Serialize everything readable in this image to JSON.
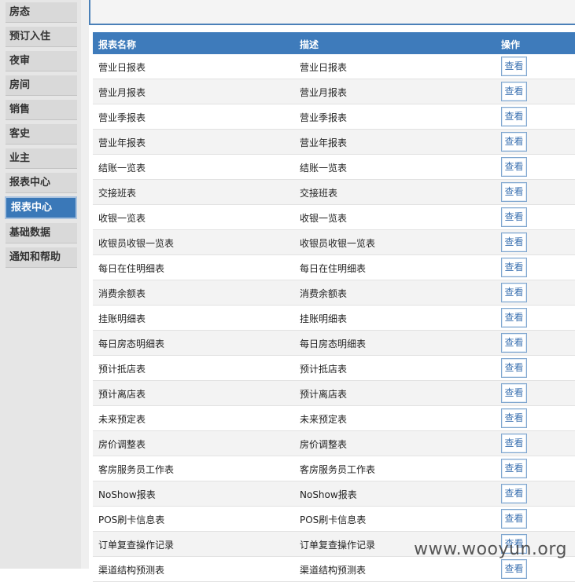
{
  "sidebar": {
    "items": [
      {
        "label": "房态"
      },
      {
        "label": "预订入住"
      },
      {
        "label": "夜审"
      },
      {
        "label": "房间"
      },
      {
        "label": "销售"
      },
      {
        "label": "客史"
      },
      {
        "label": "业主"
      },
      {
        "label": "报表中心"
      },
      {
        "label": "报表中心",
        "active": true
      },
      {
        "label": "基础数据"
      },
      {
        "label": "通知和帮助"
      }
    ]
  },
  "table": {
    "headers": {
      "name": "报表名称",
      "desc": "描述",
      "action": "操作"
    },
    "view_label": "查看",
    "rows": [
      {
        "name": "营业日报表",
        "desc": "营业日报表"
      },
      {
        "name": "营业月报表",
        "desc": "营业月报表"
      },
      {
        "name": "营业季报表",
        "desc": "营业季报表"
      },
      {
        "name": "营业年报表",
        "desc": "营业年报表"
      },
      {
        "name": "结账一览表",
        "desc": "结账一览表"
      },
      {
        "name": "交接班表",
        "desc": "交接班表"
      },
      {
        "name": "收银一览表",
        "desc": "收银一览表"
      },
      {
        "name": "收银员收银一览表",
        "desc": "收银员收银一览表"
      },
      {
        "name": "每日在住明细表",
        "desc": "每日在住明细表"
      },
      {
        "name": "消费余额表",
        "desc": "消费余额表"
      },
      {
        "name": "挂账明细表",
        "desc": "挂账明细表"
      },
      {
        "name": "每日房态明细表",
        "desc": "每日房态明细表"
      },
      {
        "name": "预计抵店表",
        "desc": "预计抵店表"
      },
      {
        "name": "预计离店表",
        "desc": "预计离店表"
      },
      {
        "name": "未来预定表",
        "desc": "未来预定表"
      },
      {
        "name": "房价调整表",
        "desc": "房价调整表"
      },
      {
        "name": "客房服务员工作表",
        "desc": "客房服务员工作表"
      },
      {
        "name": "NoShow报表",
        "desc": "NoShow报表"
      },
      {
        "name": "POS刷卡信息表",
        "desc": "POS刷卡信息表"
      },
      {
        "name": "订单复查操作记录",
        "desc": "订单复查操作记录"
      },
      {
        "name": "渠道结构预测表",
        "desc": "渠道结构预测表"
      }
    ]
  },
  "watermark": "www.wooyun.org"
}
